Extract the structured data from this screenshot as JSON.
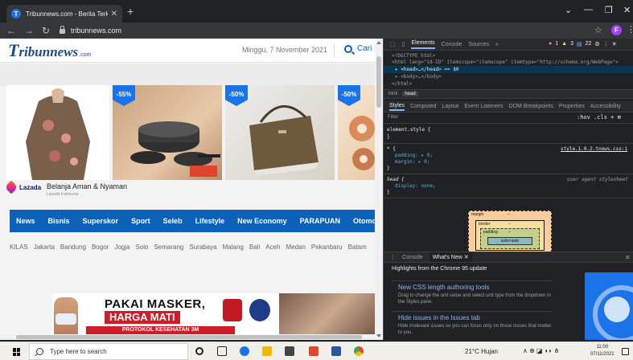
{
  "browser": {
    "tab_title": "Tribunnews.com - Berita Terkini",
    "tab_favicon_letter": "T",
    "tab_close": "✕",
    "new_tab": "+",
    "url": "tribunnews.com",
    "profile_initial": "F",
    "controls": {
      "collapse": "⌄",
      "minimize": "—",
      "maximize": "❐",
      "close": "✕"
    },
    "nav": {
      "back": "←",
      "forward": "→",
      "reload": "↻",
      "star": "☆",
      "menu": "⋮"
    }
  },
  "site": {
    "logo_t": "T",
    "logo_main": "ribunnews",
    "logo_sub": ".com",
    "date": "Minggu, 7 November 2021",
    "search_label": "Cari",
    "badges": [
      "-55%",
      "-50%",
      "-50%"
    ],
    "promo_brand": "Lazada",
    "promo_title": "Belanja Aman & Nyaman",
    "promo_sub": "Lazada Indonesia",
    "nav_items": [
      "News",
      "Bisnis",
      "Superskor",
      "Sport",
      "Seleb",
      "Lifestyle",
      "New Economy",
      "PARAPUAN",
      "Otomo"
    ],
    "sub_nav": [
      "KILAS",
      "Jakarta",
      "Bandung",
      "Bogor",
      "Jogja",
      "Solo",
      "Semarang",
      "Surabaya",
      "Malang",
      "Bali",
      "Aceh",
      "Medan",
      "Pekanbaru",
      "Batam"
    ],
    "ad_line1": "PAKAI MASKER,",
    "ad_line2": "HARGA MATI",
    "ad_line3": "PROTOKOL KESEHATAN 3M"
  },
  "devtools": {
    "tabs": [
      "Elements",
      "Console",
      "Sources",
      "»"
    ],
    "status": {
      "errors": "1",
      "warnings": "3",
      "info": "22"
    },
    "doctype": "<!DOCTYPE html>",
    "html_open": "<html lang=\"id-ID\" itemscope=\"itemscope\" itemtype=\"http://schema.org/WebPage\">",
    "head_line": "▸ <head>…</head> == $0",
    "body_line": "▸ <body>…</body>",
    "html_close": "</html>",
    "crumbs": [
      "html",
      "head"
    ],
    "style_tabs": [
      "Styles",
      "Computed",
      "Layout",
      "Event Listeners",
      "DOM Breakpoints",
      "Properties",
      "Accessibility"
    ],
    "filter_placeholder": "Filter",
    "filter_tools": ":hov .cls + ⊞",
    "rule1_selector": "element.style {",
    "rule2_selector": "* {",
    "rule2_source": "style.1.0.2.tnews.css:1",
    "rule2_props": [
      "padding: ▸ 0;",
      "margin: ▸ 0;"
    ],
    "rule3_selector": "head {",
    "rule3_source": "user agent stylesheet",
    "rule3_props": [
      "display: none;"
    ],
    "close_brace": "}",
    "box_margin": "margin",
    "box_border": "border",
    "box_padding": "padding",
    "box_content": "auto×auto",
    "box_dash": "–",
    "drawer_tabs": [
      "Console",
      "What's New ✕"
    ],
    "drawer_close": "✕",
    "whats_new_head": "Highlights from the Chrome 95 update",
    "cards": [
      {
        "title": "New CSS length authoring tools",
        "desc": "Drag to change the unit value and select unit type from the dropdown in the Styles pane."
      },
      {
        "title": "Hide issues in the Issues tab",
        "desc": "Hide irrelevant issues so you can focus only on those issues that matter to you."
      }
    ]
  },
  "taskbar": {
    "search_placeholder": "Type here to search",
    "weather": "21°C  Hujan",
    "tray": "∧  ⊕  ◪  ◖◗  ⋔",
    "time": "11:00",
    "date": "07/11/2021"
  }
}
